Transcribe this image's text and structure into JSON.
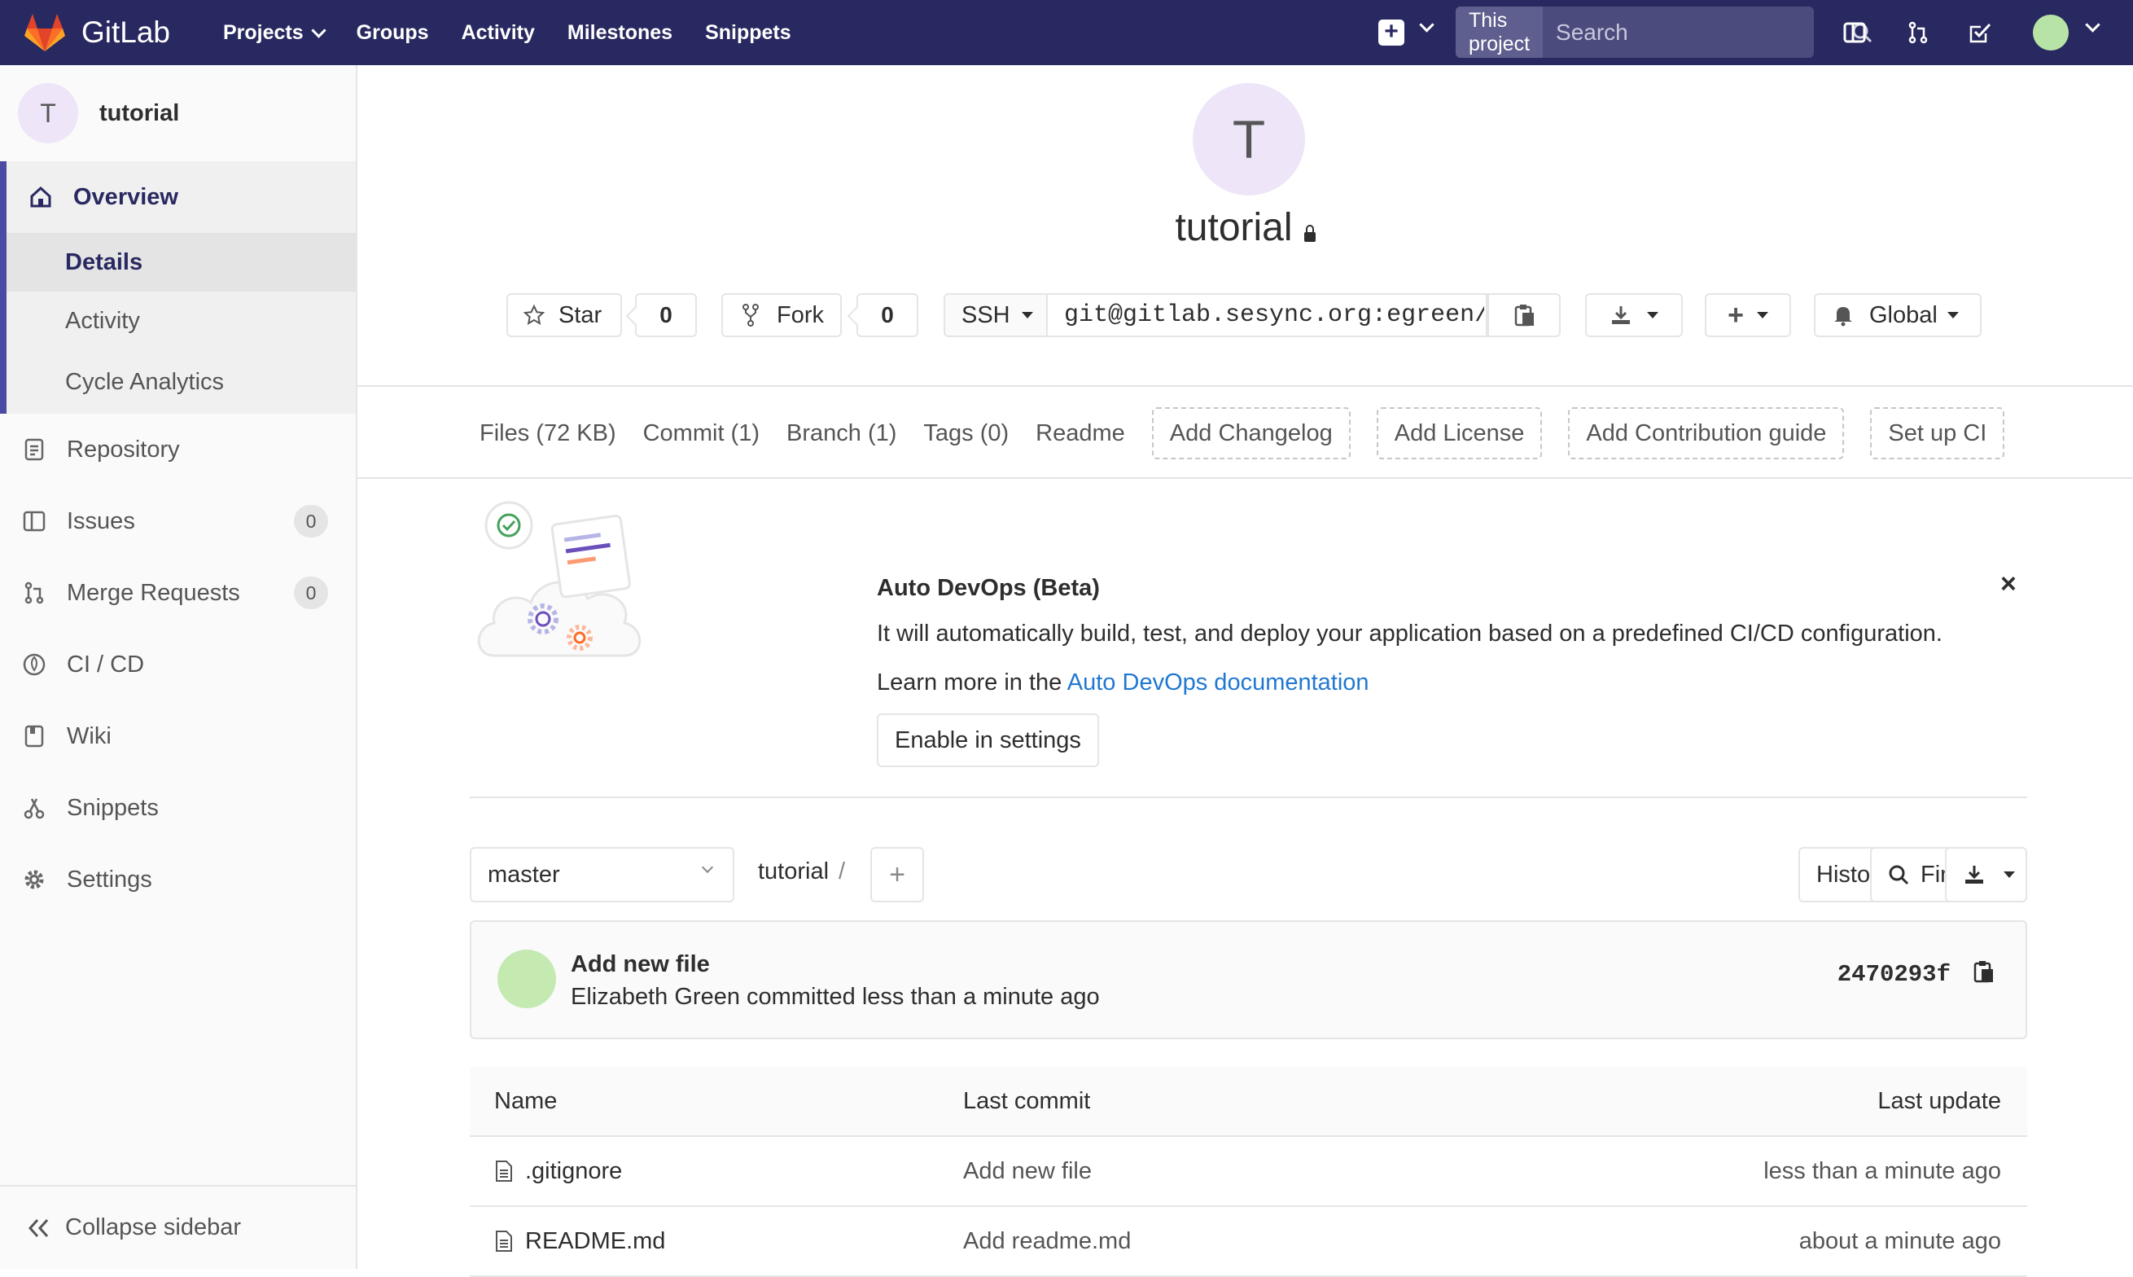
{
  "topnav": {
    "brand": "GitLab",
    "links": [
      "Projects",
      "Groups",
      "Activity",
      "Milestones",
      "Snippets"
    ],
    "search_scope": "This project",
    "search_placeholder": "Search",
    "icons": [
      "plus-square-icon",
      "sidebar-panel-icon",
      "merge-request-icon",
      "todo-check-icon"
    ]
  },
  "sidebar": {
    "project_initial": "T",
    "project_name": "tutorial",
    "overview": "Overview",
    "sub_items": [
      "Details",
      "Activity",
      "Cycle Analytics"
    ],
    "items": [
      {
        "label": "Repository",
        "icon": "repository-icon"
      },
      {
        "label": "Issues",
        "icon": "issues-icon",
        "count": "0"
      },
      {
        "label": "Merge Requests",
        "icon": "merge-request-icon",
        "count": "0"
      },
      {
        "label": "CI / CD",
        "icon": "rocket-icon"
      },
      {
        "label": "Wiki",
        "icon": "book-icon"
      },
      {
        "label": "Snippets",
        "icon": "scissors-icon"
      },
      {
        "label": "Settings",
        "icon": "gear-icon"
      }
    ],
    "collapse": "Collapse sidebar"
  },
  "project": {
    "initial": "T",
    "title": "tutorial",
    "star_label": "Star",
    "star_count": "0",
    "fork_label": "Fork",
    "fork_count": "0",
    "protocol": "SSH",
    "clone_url": "git@gitlab.sesync.org:egreen/t",
    "notification": "Global"
  },
  "stats": {
    "files": "Files (72 KB)",
    "commit": "Commit (1)",
    "branch": "Branch (1)",
    "tags": "Tags (0)",
    "readme": "Readme",
    "add_changelog": "Add Changelog",
    "add_license": "Add License",
    "add_contribution": "Add Contribution guide",
    "setup_ci": "Set up CI"
  },
  "devops": {
    "title": "Auto DevOps (Beta)",
    "description": "It will automatically build, test, and deploy your application based on a predefined CI/CD configuration.",
    "learn_prefix": "Learn more in the",
    "learn_link": "Auto DevOps documentation",
    "button": "Enable in settings",
    "close": "×"
  },
  "tree": {
    "branch": "master",
    "path": "tutorial",
    "slash": "/",
    "history": "History",
    "find_file": "Find file"
  },
  "commit": {
    "title": "Add new file",
    "meta": "Elizabeth Green committed less than a minute ago",
    "sha": "2470293f"
  },
  "files": {
    "headers": [
      "Name",
      "Last commit",
      "Last update"
    ],
    "rows": [
      {
        "name": ".gitignore",
        "commit": "Add new file",
        "updated": "less than a minute ago"
      },
      {
        "name": "README.md",
        "commit": "Add readme.md",
        "updated": "about a minute ago"
      }
    ]
  },
  "colors": {
    "nav_bg": "#292961",
    "accent": "#4b4ba3",
    "link": "#1f78d1"
  }
}
